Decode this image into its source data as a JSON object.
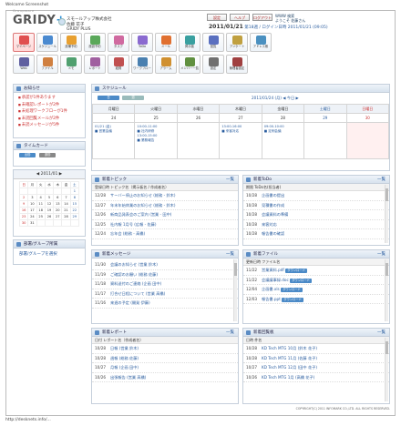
{
  "caption_top": "Welcome Screenshot",
  "caption_bottom": "http://desknets.info/...",
  "logo": {
    "brand": "GRIDY",
    "plus": "+",
    "small": "Groupware"
  },
  "company": {
    "name": "スモールアップ株式会社",
    "line2": "佐藤 花子",
    "line3": "GRIDY PLUS"
  },
  "header_buttons": [
    "設定",
    "ヘルプ",
    "ログアウト"
  ],
  "user_info": {
    "line1": "WWW  検索",
    "line2": "ようこそ 佐藤さん"
  },
  "date": {
    "main": "2011/01/21",
    "sub": "第18週 / ログイン日時 2011/01/21 (09:05)"
  },
  "icons": [
    {
      "label": "マイページ",
      "color": "#e05050"
    },
    {
      "label": "スケジュール",
      "color": "#4a8ad0"
    },
    {
      "label": "設備予約",
      "color": "#e8a030"
    },
    {
      "label": "施設予約",
      "color": "#5aa85a"
    },
    {
      "label": "タスク",
      "color": "#d06aa0"
    },
    {
      "label": "ToDo",
      "color": "#8a6ad0"
    },
    {
      "label": "メール",
      "color": "#e07030"
    },
    {
      "label": "掲示板",
      "color": "#3aa0a0"
    },
    {
      "label": "回覧",
      "color": "#5a70c0"
    },
    {
      "label": "アンケート",
      "color": "#c0a040"
    },
    {
      "label": "アドレス帳",
      "color": "#4a90c0"
    },
    {
      "label": "Web",
      "color": "#6060a0"
    },
    {
      "label": "ファイル",
      "color": "#d08040"
    },
    {
      "label": "メモ",
      "color": "#50a070"
    },
    {
      "label": "レポート",
      "color": "#a060a0"
    },
    {
      "label": "経費",
      "color": "#c05050"
    },
    {
      "label": "ワークフロー",
      "color": "#4a80b0"
    },
    {
      "label": "アラーム",
      "color": "#d09030"
    },
    {
      "label": "メンバー一覧",
      "color": "#609040"
    },
    {
      "label": "設定",
      "color": "#707070"
    },
    {
      "label": "管理者設定",
      "color": "#a04040"
    }
  ],
  "notice": {
    "title": "お知らせ",
    "items": [
      "承認が1件あります",
      "未確認レポートが2件",
      "未処理ワークフローが1件",
      "未読回覧メールが2件",
      "未読メッセージが5件"
    ]
  },
  "timecard": {
    "title": "タイムカード",
    "in": "出勤",
    "out": "退勤",
    "date": "2011/01/21"
  },
  "calendar": {
    "title": "2011/01",
    "days": [
      "日",
      "月",
      "火",
      "水",
      "木",
      "金",
      "土"
    ],
    "weeks": [
      [
        "",
        "",
        "",
        "",
        "",
        "",
        "1"
      ],
      [
        "2",
        "3",
        "4",
        "5",
        "6",
        "7",
        "8"
      ],
      [
        "9",
        "10",
        "11",
        "12",
        "13",
        "14",
        "15"
      ],
      [
        "16",
        "17",
        "18",
        "19",
        "20",
        "21",
        "22"
      ],
      [
        "23",
        "24",
        "25",
        "26",
        "27",
        "28",
        "29"
      ],
      [
        "30",
        "31",
        "",
        "",
        "",
        "",
        ""
      ]
    ]
  },
  "groups": {
    "title": "部署/グループ所属",
    "link": "部署/グループを選択"
  },
  "schedule": {
    "title": "スケジュール",
    "btn_day": "日",
    "btn_week": "週",
    "nav": "2011/01/24 (月) ◀ 今日 ▶",
    "days": [
      "月曜日",
      "火曜日",
      "水曜日",
      "木曜日",
      "金曜日",
      "土曜日",
      "日曜日"
    ],
    "dates": [
      "24",
      "25",
      "26",
      "27",
      "28",
      "29",
      "30"
    ],
    "events": [
      "01/21 (金)\n■ 営業会議",
      "10:00-11:00\n■ 社内研修\n13:00-15:00\n■ 業務報告",
      "",
      "13:00-16:00\n■ 来客対応",
      "09:00-10:00\n■ 定例会議",
      "",
      ""
    ]
  },
  "topics": {
    "title": "新着トピック",
    "more": "一覧",
    "head": "登録日時   トピック名（掲示板名 / 作成者名）",
    "rows": [
      {
        "d": "12/28",
        "t": "サーバー停止のお知らせ (総務 - 鈴木)"
      },
      {
        "d": "12/27",
        "t": "年末年始休業のお知らせ (総務 - 鈴木)"
      },
      {
        "d": "12/26",
        "t": "新商品発表会のご案内 (営業 - 田中)"
      },
      {
        "d": "12/25",
        "t": "社内報 1月号 (広報 - 佐藤)"
      },
      {
        "d": "12/24",
        "t": "忘年会 (総務 - 高橋)"
      }
    ]
  },
  "todo": {
    "title": "新着ToDo",
    "more": "一覧",
    "head": "期限   ToDo名(担当者)",
    "rows": [
      {
        "d": "10/28",
        "t": "企画書の提出"
      },
      {
        "d": "10/28",
        "t": "見積書の作成"
      },
      {
        "d": "10/28",
        "t": "会議資料の準備"
      },
      {
        "d": "10/28",
        "t": "来客対応"
      },
      {
        "d": "10/28",
        "t": "報告書の確認"
      }
    ]
  },
  "messages": {
    "title": "新着メッセージ",
    "more": "一覧",
    "rows": [
      {
        "d": "11/30",
        "t": "会議のお知らせ (営業 鈴木)"
      },
      {
        "d": "11/19",
        "t": "ご確認のお願い (総務 佐藤)"
      },
      {
        "d": "11/18",
        "t": "資料送付のご連絡 (企画 田中)"
      },
      {
        "d": "11/17",
        "t": "打合せ日程について (営業 高橋)"
      },
      {
        "d": "11/16",
        "t": "来週の予定 (開発 伊藤)"
      }
    ]
  },
  "files": {
    "title": "新着ファイル",
    "more": "一覧",
    "head": "更新日時   ファイル名",
    "rows": [
      {
        "d": "11/22",
        "t": "営業資料.pdf",
        "tag": "ダウンロード"
      },
      {
        "d": "11/22",
        "t": "会議議事録.doc",
        "tag": "ダウンロード"
      },
      {
        "d": "12/04",
        "t": "企画書.xls",
        "tag": "ダウンロード"
      },
      {
        "d": "12/03",
        "t": "報告書.ppt",
        "tag": "ダウンロード"
      }
    ]
  },
  "reports": {
    "title": "新着レポート",
    "more": "一覧",
    "head": "日付   レポート名（作成者名）",
    "rows": [
      {
        "d": "10/28",
        "t": "日報 (営業 鈴木)"
      },
      {
        "d": "10/28",
        "t": "週報 (総務 佐藤)"
      },
      {
        "d": "10/27",
        "t": "月報 (企画 田中)"
      },
      {
        "d": "10/26",
        "t": "出張報告 (営業 高橋)"
      }
    ]
  },
  "workflow": {
    "title": "新着回覧板",
    "more": "一覧",
    "head": "日時   件名",
    "rows": [
      {
        "d": "10/28",
        "t": "KD Tech MTG 10月 (鈴木 花子)"
      },
      {
        "d": "10/28",
        "t": "KD Tech MTG 11月 (佐藤 花子)"
      },
      {
        "d": "10/27",
        "t": "KD Tech MTG 12月 (田中 花子)"
      },
      {
        "d": "10/26",
        "t": "KD Tech MTG 1月 (高橋 花子)"
      }
    ]
  },
  "footer": "COPYRIGHT(C) 2011 INFOMARK CO.,LTD. ALL RIGHTS RESERVED."
}
